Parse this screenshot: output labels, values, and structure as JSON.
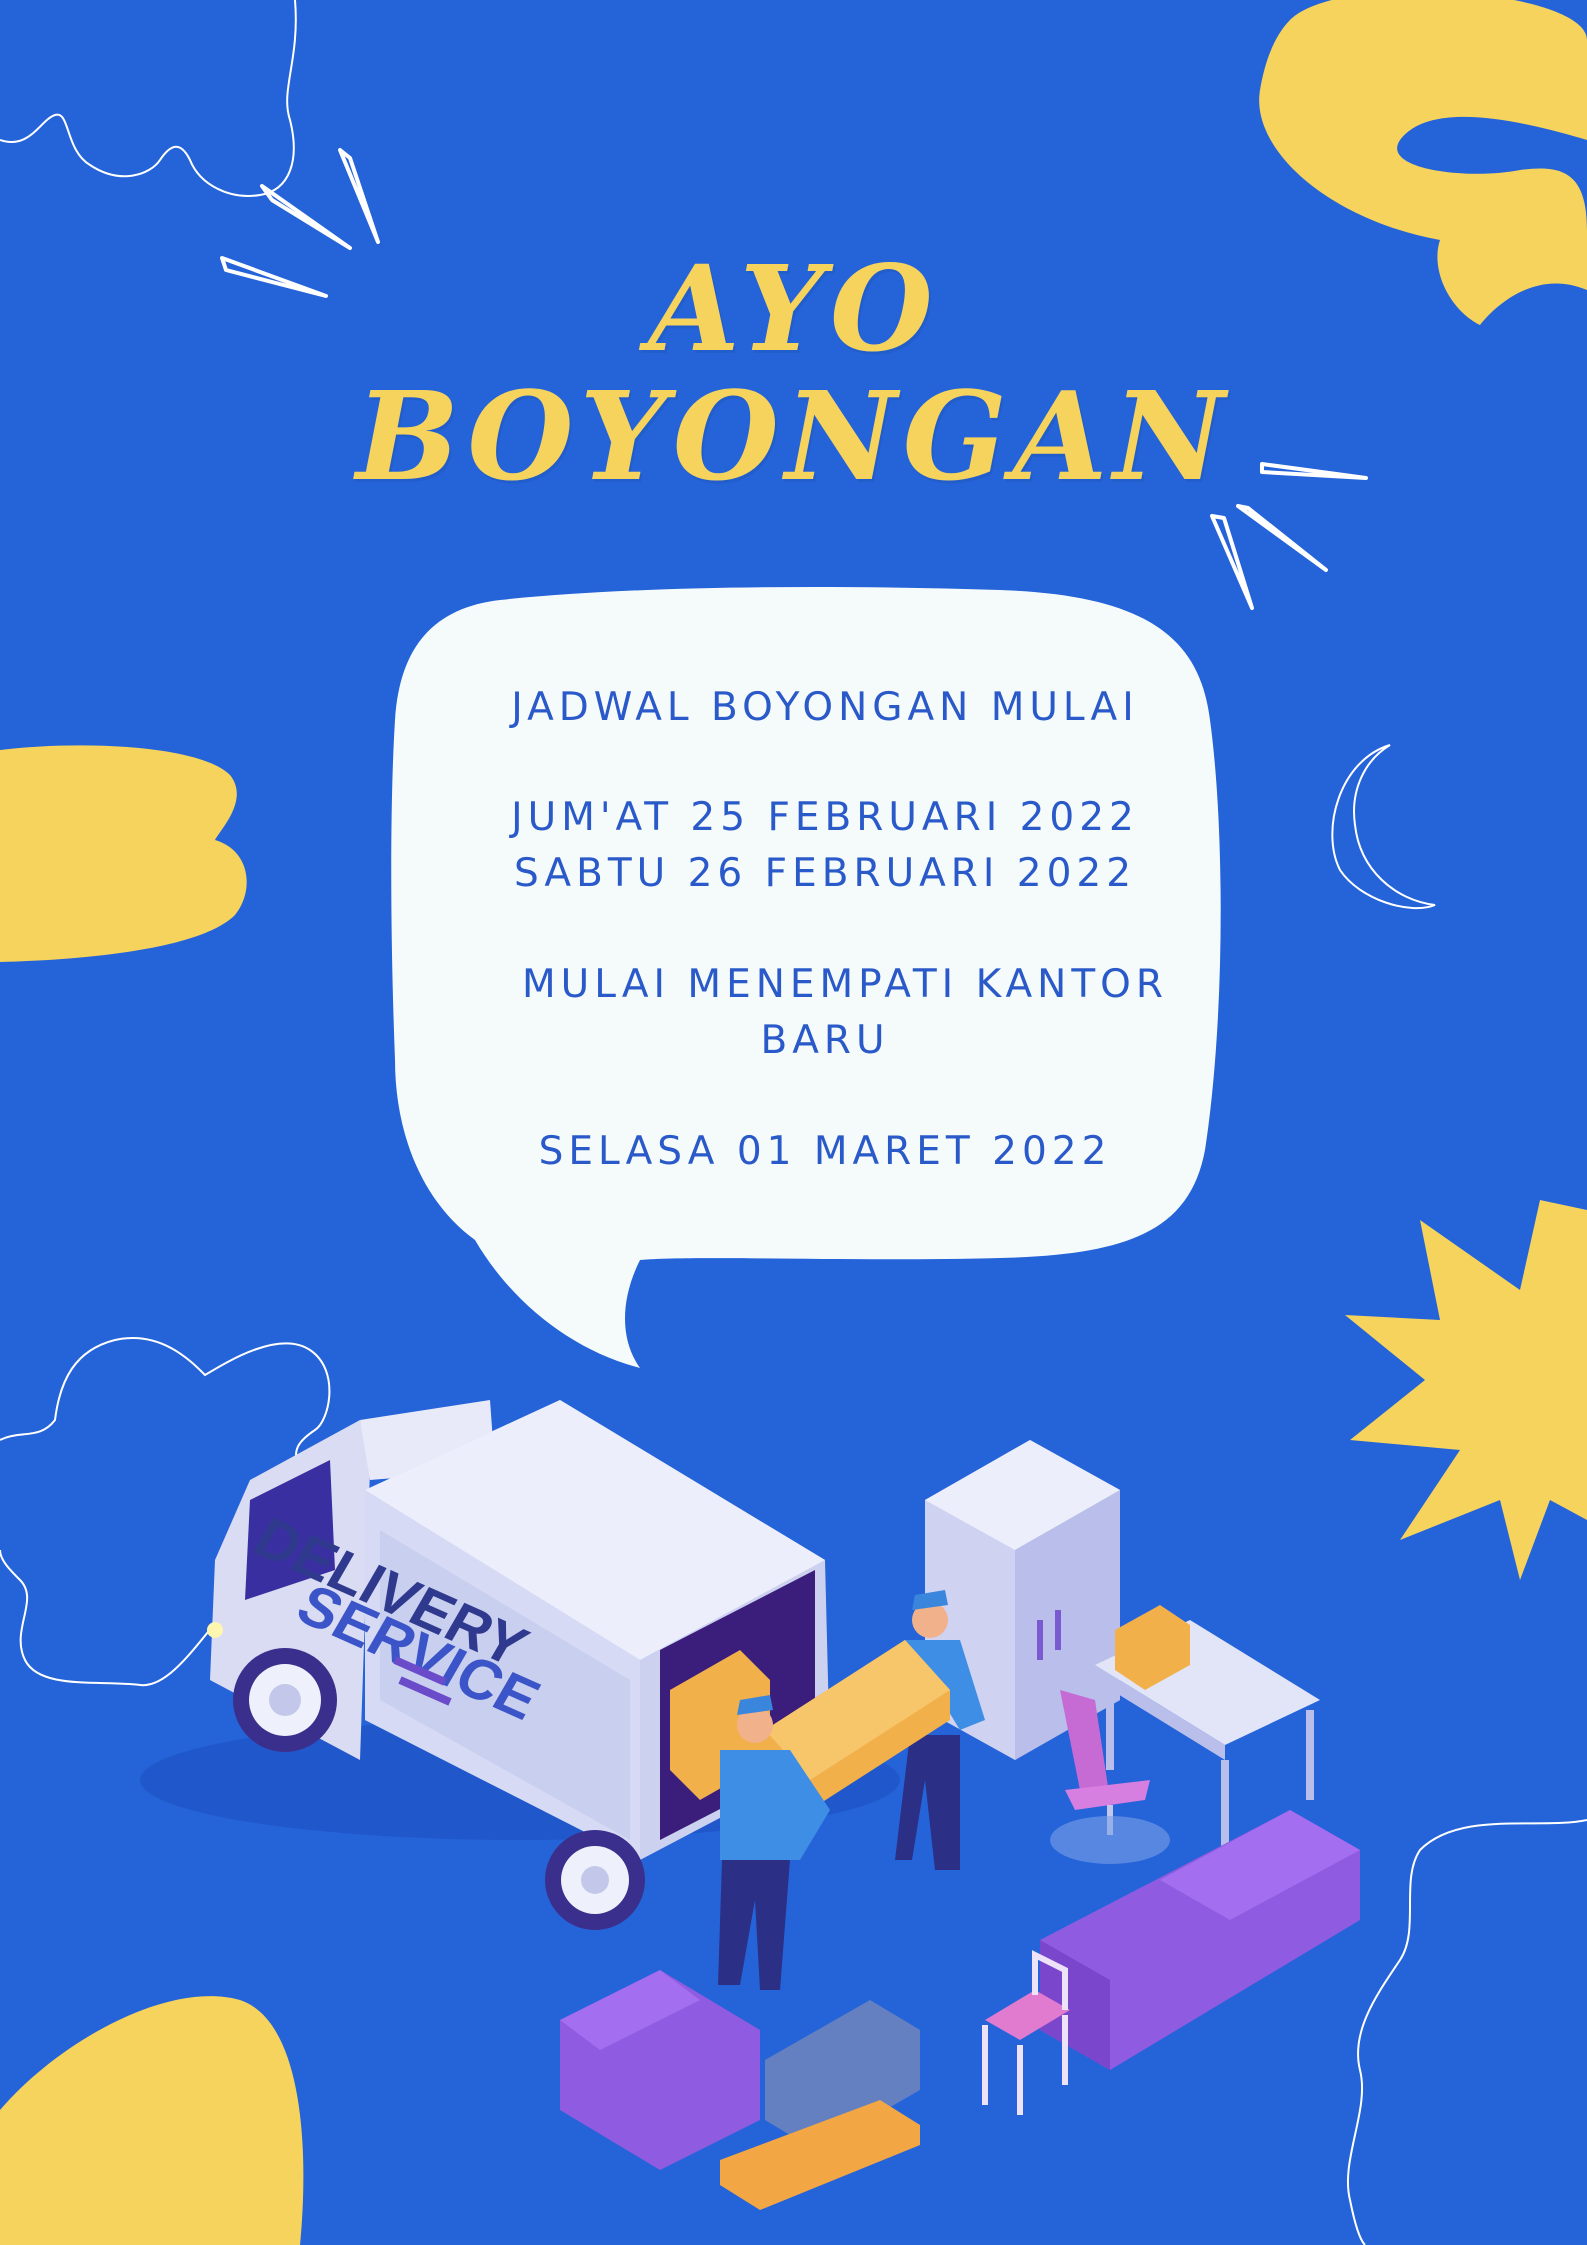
{
  "title": {
    "line1": "AYO",
    "line2": "BOYONGAN"
  },
  "bubble": {
    "schedule_heading": "JADWAL BOYONGAN MULAI",
    "date_1": "JUM'AT 25 FEBRUARI 2022",
    "date_2": "SABTU 26 FEBRUARI 2022",
    "occupy_line_1": "MULAI MENEMPATI KANTOR",
    "occupy_line_2": "BARU",
    "occupy_date": "SELASA 01 MARET 2022"
  },
  "truck": {
    "sign_line_1": "DELIVERY",
    "sign_line_2": "SERVICE"
  },
  "colors": {
    "background": "#2563d9",
    "accent_yellow": "#f5d35c",
    "bubble": "#f5fbfb",
    "text_blue": "#2a59c9"
  }
}
